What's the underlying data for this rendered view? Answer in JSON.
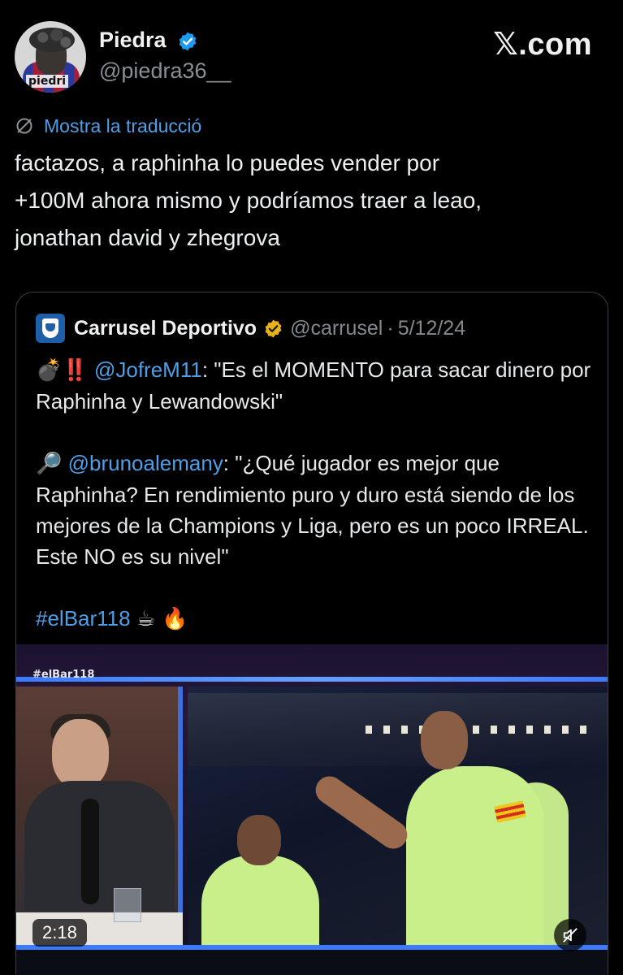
{
  "author": {
    "name": "Piedra",
    "handle": "@piedra36__",
    "avatar_text": "piedri"
  },
  "brand": {
    "x": "𝕏",
    "suffix": ".com"
  },
  "translate": {
    "label": "Mostra la traducció"
  },
  "tweet": {
    "text": "factazos, a raphinha lo puedes vender por\n+100M ahora mismo y podríamos traer a leao,\njonathan david y zhegrova"
  },
  "quote": {
    "name": "Carrusel Deportivo",
    "handle": "@carrusel",
    "dot": "·",
    "date": "5/12/24",
    "line1": {
      "emoji_bomb": "💣",
      "emoji_alert": "‼️",
      "mention": "@JofreM11",
      "text": ": \"Es el MOMENTO para sacar dinero por Raphinha y Lewandowski\""
    },
    "line2": {
      "emoji": "🔎",
      "mention": "@brunoalemany",
      "text": ": \"¿Qué jugador es mejor que Raphinha? En rendimiento puro y duro está siendo de los mejores de la Champions y Liga, pero es un poco IRREAL. Este NO es su nivel\""
    },
    "line3": {
      "hashtag": "#elBar118",
      "emoji": "☕ 🔥"
    }
  },
  "video": {
    "tag": "#elBar118",
    "duration": "2:18"
  },
  "colors": {
    "link": "#4e9fe6",
    "verified": "#1d9bf0",
    "gold_verified": "#e8b21a",
    "background": "#000000"
  },
  "icons": {
    "verified": "verified-badge-icon",
    "translate": "translate-icon",
    "mute": "volume-muted-icon"
  }
}
